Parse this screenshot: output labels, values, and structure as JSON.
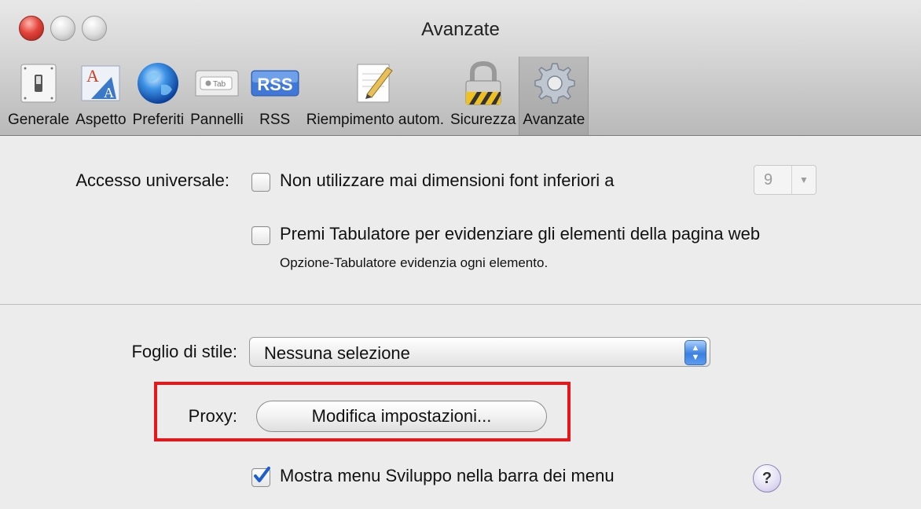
{
  "window": {
    "title": "Avanzate"
  },
  "toolbar": {
    "items": [
      {
        "label": "Generale",
        "icon": "switch-icon"
      },
      {
        "label": "Aspetto",
        "icon": "font-icon"
      },
      {
        "label": "Preferiti",
        "icon": "globe-icon"
      },
      {
        "label": "Pannelli",
        "icon": "tab-icon",
        "icon_text": "Tab"
      },
      {
        "label": "RSS",
        "icon": "rss-icon",
        "icon_text": "RSS"
      },
      {
        "label": "Riempimento autom.",
        "icon": "pencil-icon"
      },
      {
        "label": "Sicurezza",
        "icon": "lock-icon"
      },
      {
        "label": "Avanzate",
        "icon": "gear-icon",
        "selected": true
      }
    ]
  },
  "accessibility": {
    "label": "Accesso universale:",
    "min_font": {
      "label": "Non utilizzare mai dimensioni font inferiori a",
      "checked": false,
      "value": "9"
    },
    "tab_highlight": {
      "label": "Premi Tabulatore per evidenziare gli elementi della pagina web",
      "checked": false,
      "note": "Opzione-Tabulatore evidenzia ogni elemento."
    }
  },
  "stylesheet": {
    "label": "Foglio di stile:",
    "value": "Nessuna selezione"
  },
  "proxy": {
    "label": "Proxy:",
    "button": "Modifica impostazioni..."
  },
  "develop_menu": {
    "label": "Mostra menu Sviluppo nella barra dei menu",
    "checked": true,
    "help": "?"
  },
  "colors": {
    "highlight": "#e8151b",
    "accent": "#3b7fe0"
  }
}
